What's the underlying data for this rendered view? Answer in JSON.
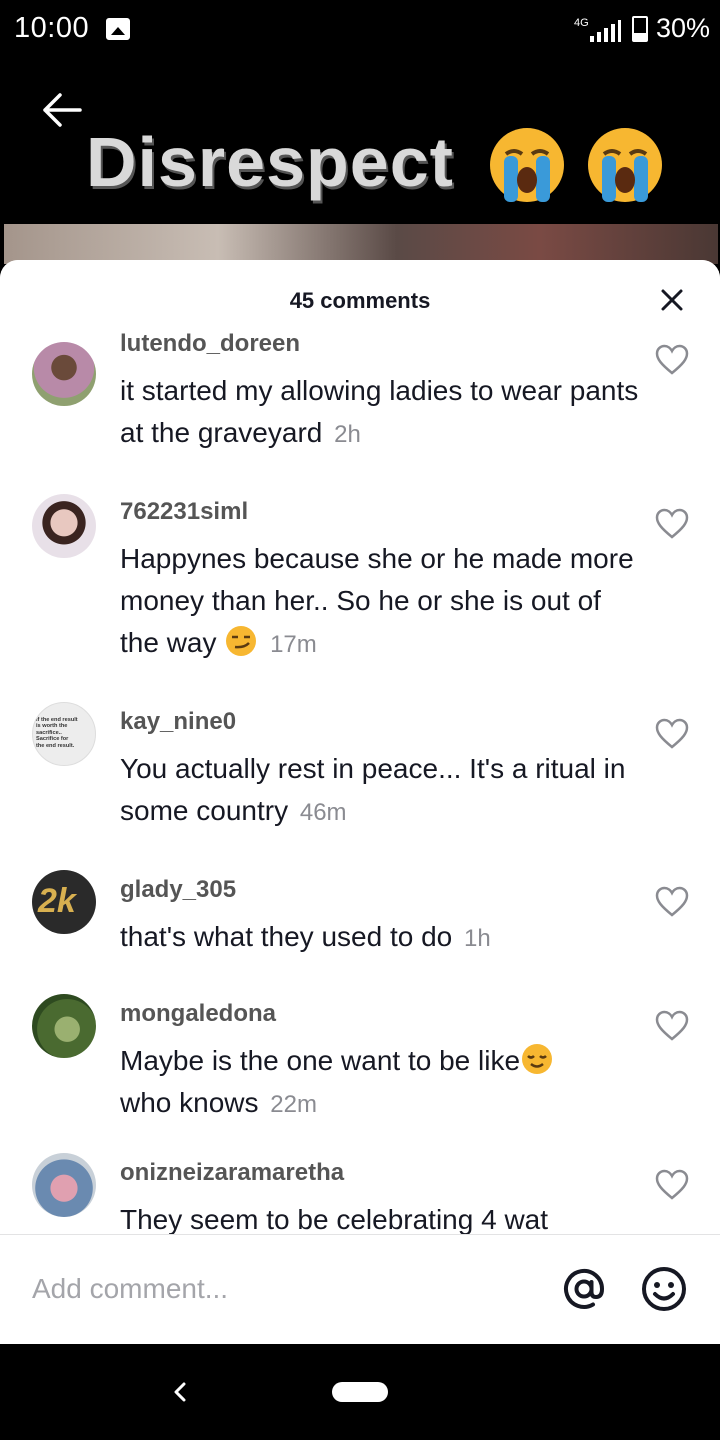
{
  "status_bar": {
    "time": "10:00",
    "network": "4G",
    "battery": "30%",
    "battery_level": 0.3,
    "icons": [
      "image-notification-icon",
      "signal-icon",
      "battery-icon"
    ]
  },
  "video": {
    "title_text": "Disrespect",
    "title_emojis": [
      "loudly-crying-emoji",
      "loudly-crying-emoji"
    ]
  },
  "comments_sheet": {
    "title": "45 comments",
    "close_icon": "close-icon",
    "comments": [
      {
        "username": "lutendo_doreen",
        "text": "it started my allowing ladies to wear pants at the graveyard",
        "time": "2h"
      },
      {
        "username": "762231siml",
        "text": "Happynes because she or he made more money than her.. So he or she is out of the way",
        "emoji": "smirking-face-emoji",
        "time": "17m"
      },
      {
        "username": "kay_nine0",
        "text": "You actually rest in peace... It's a ritual in some country",
        "time": "46m",
        "avatar_text": [
          "If the end result",
          "is worth the",
          "sacrifice..",
          "Sacrifice for",
          "the end result."
        ]
      },
      {
        "username": "glady_305",
        "text": "that's what they used to do",
        "time": "1h",
        "avatar_text": "2k"
      },
      {
        "username": "mongaledona",
        "text": "Maybe is the one want to be like",
        "emoji": "relieved-face-emoji",
        "text_after": "who knows",
        "time": "22m"
      },
      {
        "username": "onizneizaramaretha",
        "text": "They seem to be celebrating 4 wat",
        "time": ""
      }
    ]
  },
  "input_bar": {
    "placeholder": "Add comment...",
    "mention_icon": "at-sign-icon",
    "emoji_icon": "emoji-icon"
  },
  "nav_bar": {
    "icons": [
      "nav-back-icon",
      "nav-home-pill"
    ]
  },
  "colors": {
    "text_primary": "#161823",
    "text_secondary": "#8a8b91",
    "username": "#555555",
    "sheet_bg": "#ffffff",
    "background": "#000000"
  }
}
